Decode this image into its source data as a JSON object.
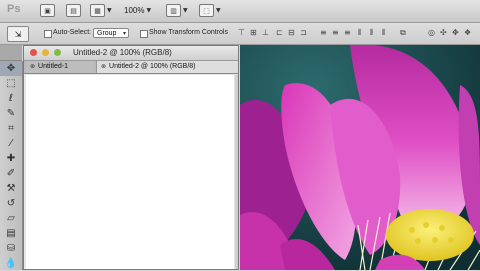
{
  "app": {
    "logo": "Ps",
    "zoom": "100%"
  },
  "icons": {
    "bridge": "br-icon",
    "minibridge": "mb-icon",
    "view_extras": "grid-icon",
    "arrange": "arrange-icon",
    "screen_mode": "screen-mode-icon"
  },
  "options_bar": {
    "auto_select_label": "Auto-Select:",
    "auto_select_value": "Group",
    "show_transform_label": "Show Transform Controls"
  },
  "document": {
    "window_title": "Untitled-2 @ 100% (RGB/8)",
    "tabs": [
      {
        "label": "Untitled-1"
      },
      {
        "label": "Untitled-2 @ 100% (RGB/8)"
      }
    ]
  },
  "colors": {
    "close_light": "#e8514b",
    "minimize_light": "#e7b33a",
    "zoom_light": "#7cbf3e",
    "petal": "#d936b8",
    "pod": "#f2e64a",
    "background_teal": "#1d4a4d"
  }
}
